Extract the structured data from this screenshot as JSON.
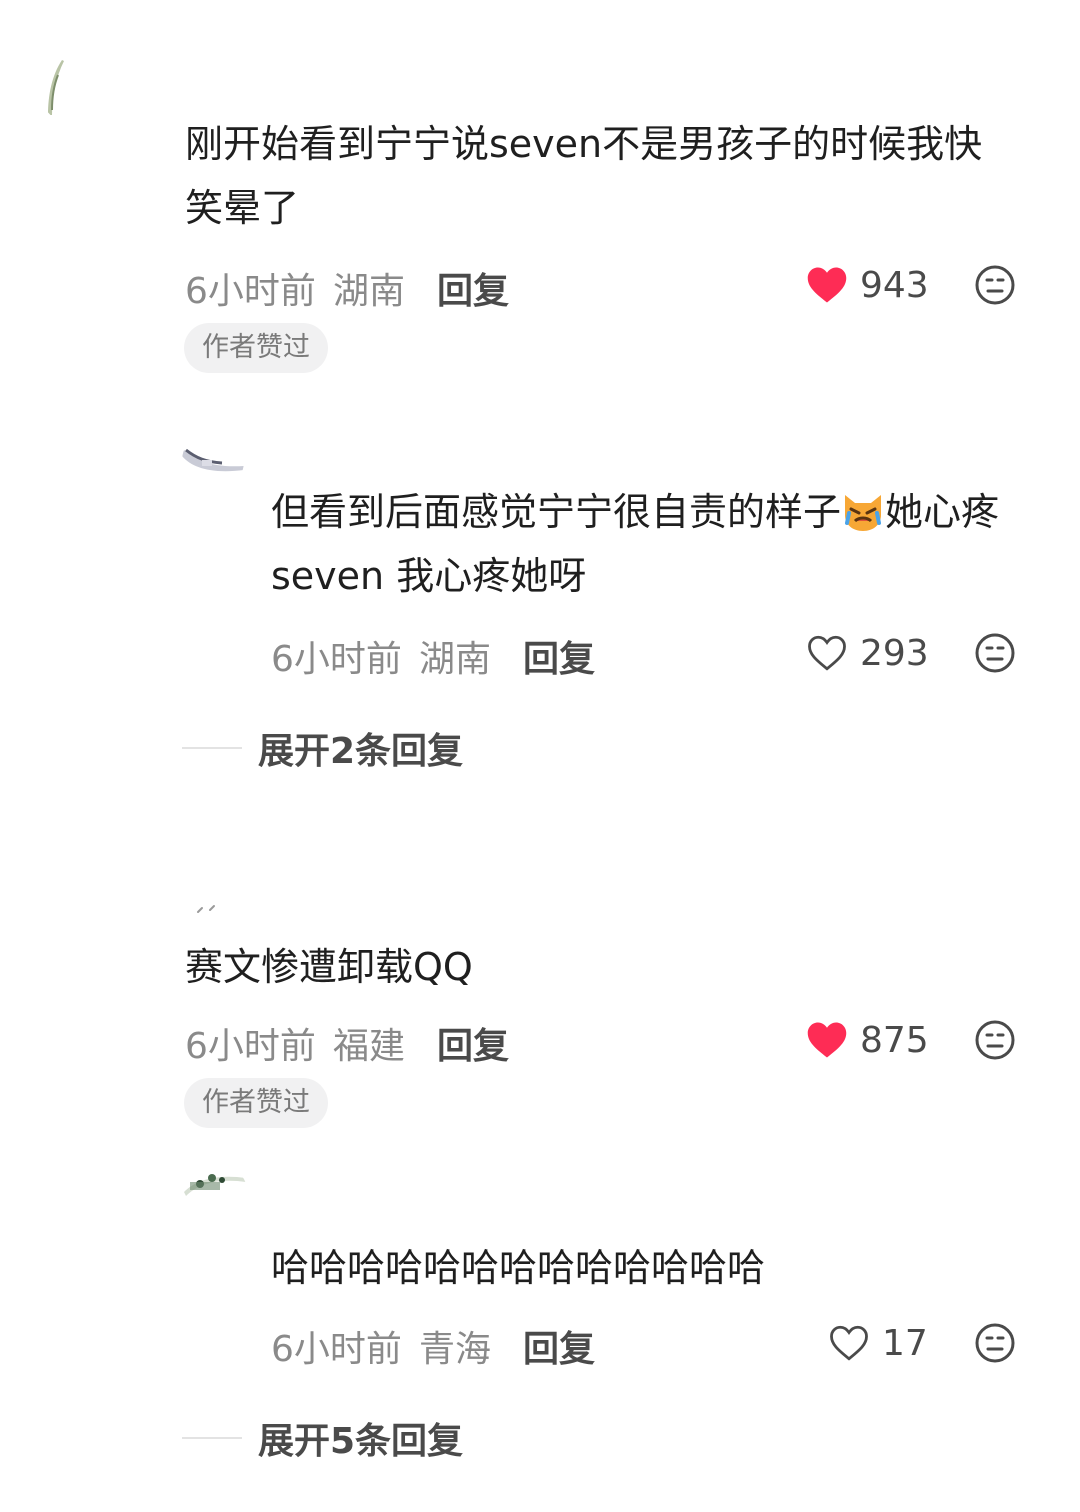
{
  "colors": {
    "like_active": "#fe2c55",
    "text_primary": "#1f1f1f",
    "text_meta": "#8a8a8a",
    "badge_bg": "#f1f1f2"
  },
  "comments": [
    {
      "text": "刚开始看到宁宁说seven不是男孩子的时候我快笑晕了",
      "time": "6小时前",
      "location": "湖南",
      "reply_label": "回复",
      "likes": "943",
      "liked": true,
      "badge": "作者赞过",
      "icon_like": "heart-filled-icon",
      "icon_dislike": "dislike-face-icon",
      "replies": [
        {
          "text_before_emoji": "但看到后面感觉宁宁很自责的样子",
          "emoji": "crying-cat-emoji",
          "text_after_emoji": "她心疼seven 我心疼她呀",
          "time": "6小时前",
          "location": "湖南",
          "reply_label": "回复",
          "likes": "293",
          "liked": false,
          "icon_like": "heart-outline-icon",
          "icon_dislike": "dislike-face-icon"
        }
      ],
      "expand_label": "展开2条回复"
    },
    {
      "text": "赛文惨遭卸载QQ",
      "time": "6小时前",
      "location": "福建",
      "reply_label": "回复",
      "likes": "875",
      "liked": true,
      "badge": "作者赞过",
      "icon_like": "heart-filled-icon",
      "icon_dislike": "dislike-face-icon",
      "replies": [
        {
          "text": "哈哈哈哈哈哈哈哈哈哈哈哈哈",
          "time": "6小时前",
          "location": "青海",
          "reply_label": "回复",
          "likes": "17",
          "liked": false,
          "icon_like": "heart-outline-icon",
          "icon_dislike": "dislike-face-icon"
        }
      ],
      "expand_label": "展开5条回复"
    }
  ]
}
